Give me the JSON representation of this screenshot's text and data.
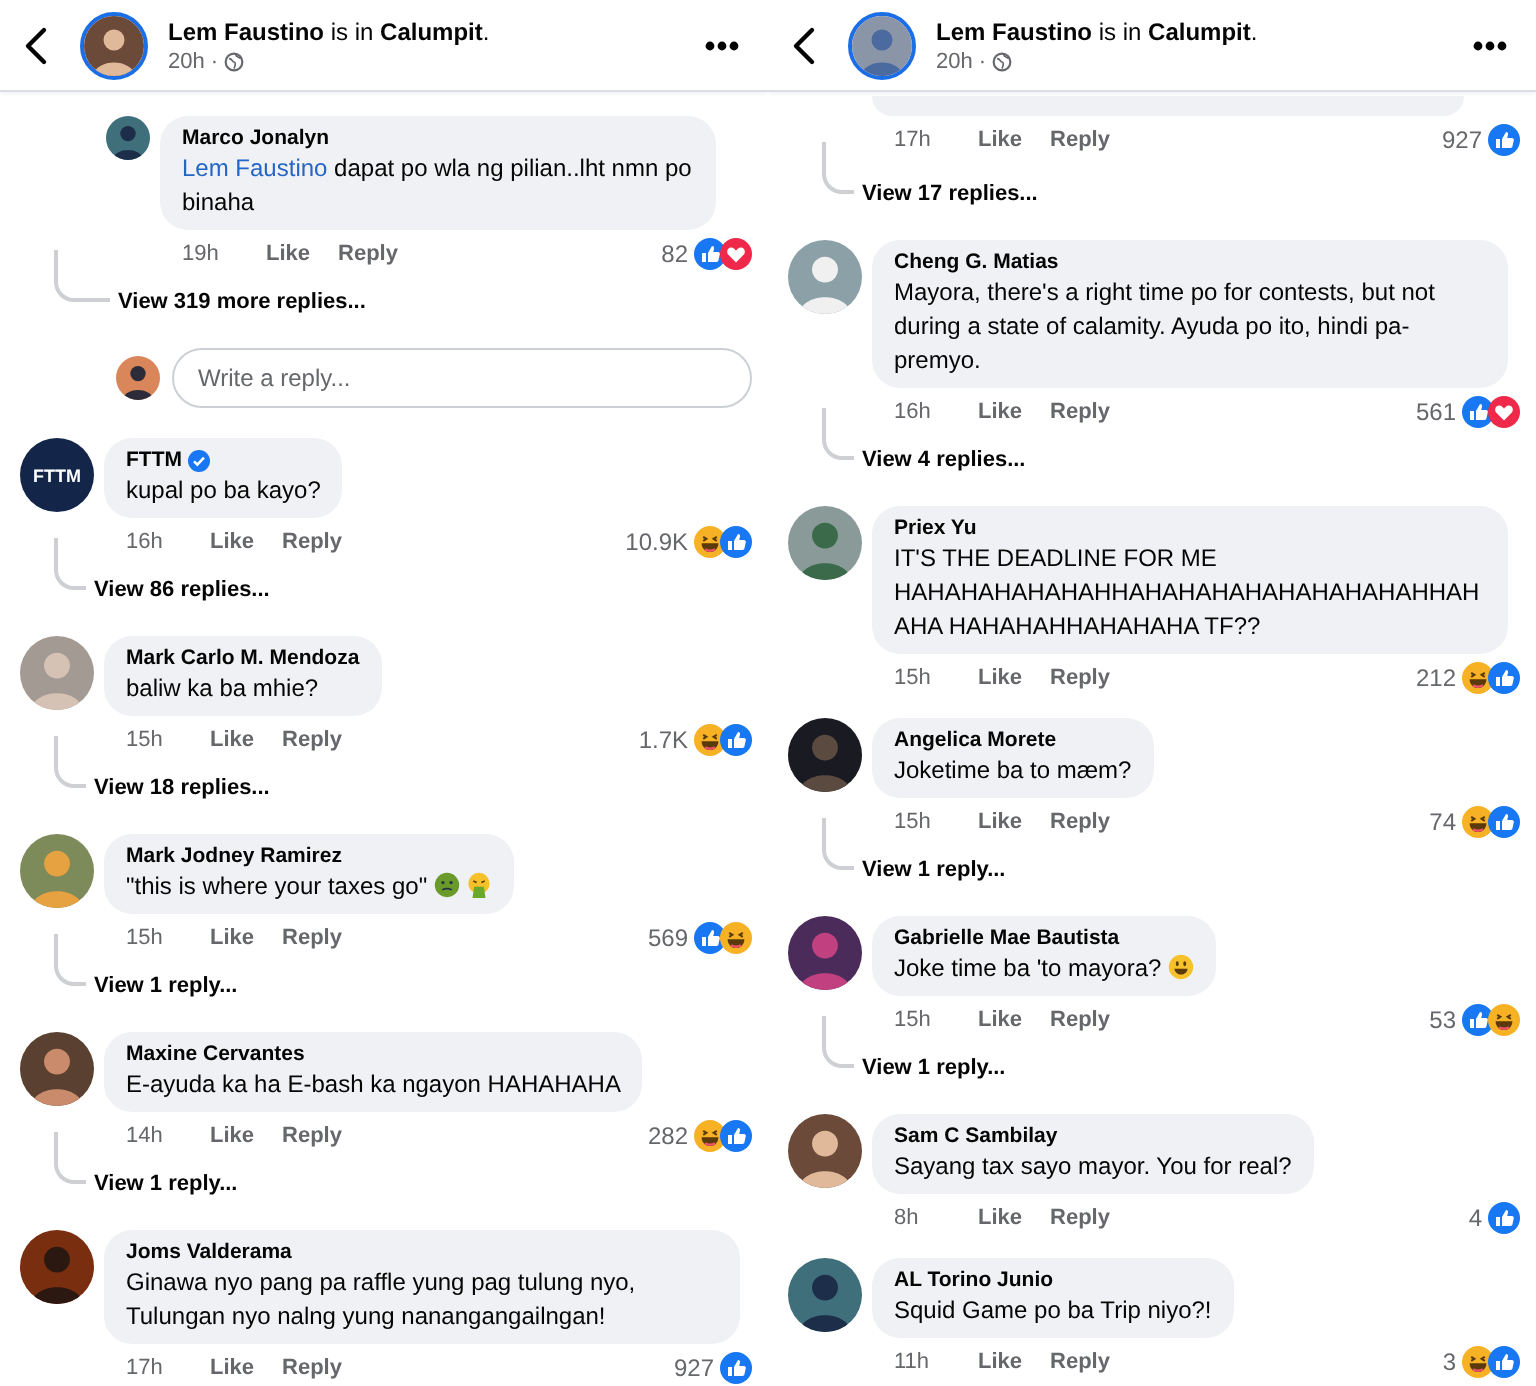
{
  "panels": [
    {
      "header": {
        "title": "**Lem Faustino** is in **Calumpit**.",
        "time": "20h ·"
      },
      "items": [
        {
          "kind": "reply",
          "author": "Marco Jonalyn",
          "verified": false,
          "mention": "Lem Faustino",
          "text": "dapat po wla ng pilian..lht nmn po binaha",
          "time": "19h",
          "like": "Like",
          "reply_label": "Reply",
          "count": "82",
          "reactions": [
            {
              "kind": "like"
            },
            {
              "kind": "love"
            }
          ]
        },
        {
          "kind": "more_replies",
          "label": "View 319 more replies..."
        },
        {
          "kind": "reply_box",
          "placeholder": "Write a reply..."
        },
        {
          "kind": "comment",
          "author": "FTTM",
          "avatar_text": "FTTM",
          "verified": true,
          "text": "kupal po ba kayo?",
          "time": "16h",
          "like": "Like",
          "reply_label": "Reply",
          "count": "10.9K",
          "reactions": [
            {
              "kind": "haha"
            },
            {
              "kind": "like"
            }
          ]
        },
        {
          "kind": "view_replies",
          "label": "View 86 replies..."
        },
        {
          "kind": "comment",
          "author": "Mark Carlo M. Mendoza",
          "verified": false,
          "text": "baliw  ka ba mhie?",
          "time": "15h",
          "like": "Like",
          "reply_label": "Reply",
          "count": "1.7K",
          "reactions": [
            {
              "kind": "haha"
            },
            {
              "kind": "like"
            }
          ]
        },
        {
          "kind": "view_replies",
          "label": "View 18 replies..."
        },
        {
          "kind": "comment",
          "author": "Mark Jodney Ramirez",
          "verified": false,
          "text": "\"this is where your taxes go\"",
          "emojis": [
            {
              "kind": "nauseated"
            },
            {
              "kind": "vomiting"
            }
          ],
          "time": "15h",
          "like": "Like",
          "reply_label": "Reply",
          "count": "569",
          "reactions": [
            {
              "kind": "like"
            },
            {
              "kind": "haha"
            }
          ]
        },
        {
          "kind": "view_replies",
          "label": "View 1 reply..."
        },
        {
          "kind": "comment",
          "author": "Maxine Cervantes",
          "verified": false,
          "text": "E-ayuda ka ha E-bash ka ngayon HAHAHAHA",
          "time": "14h",
          "like": "Like",
          "reply_label": "Reply",
          "count": "282",
          "reactions": [
            {
              "kind": "haha"
            },
            {
              "kind": "like"
            }
          ]
        },
        {
          "kind": "view_replies",
          "label": "View 1 reply..."
        },
        {
          "kind": "comment",
          "author": "Joms Valderama",
          "verified": false,
          "text": "Ginawa nyo pang pa raffle yung pag tulung nyo, Tulungan nyo nalng yung nanangangailngan!",
          "time": "17h",
          "like": "Like",
          "reply_label": "Reply",
          "count": "927",
          "reactions": [
            {
              "kind": "like"
            }
          ]
        }
      ]
    },
    {
      "header": {
        "title": "**Lem Faustino** is in **Calumpit**.",
        "time": "20h ·"
      },
      "items": [
        {
          "kind": "cut_comment",
          "time": "17h",
          "like": "Like",
          "reply_label": "Reply",
          "count": "927",
          "reactions": [
            {
              "kind": "like"
            }
          ]
        },
        {
          "kind": "view_replies",
          "label": "View 17 replies..."
        },
        {
          "kind": "comment",
          "author": "Cheng G. Matias",
          "verified": false,
          "text": "Mayora, there's a right time po for contests, but not during a state of calamity. Ayuda po ito, hindi pa-premyo.",
          "time": "16h",
          "like": "Like",
          "reply_label": "Reply",
          "count": "561",
          "reactions": [
            {
              "kind": "like"
            },
            {
              "kind": "love"
            }
          ]
        },
        {
          "kind": "view_replies",
          "label": "View 4 replies..."
        },
        {
          "kind": "comment",
          "author": "Priex Yu",
          "verified": false,
          "text": "IT'S THE DEADLINE FOR ME HAHAHAHAHAHAHHAHAHAHAHAHAHAHAHAHHAHAHA HAHAHAHHAHAHAHA TF??",
          "time": "15h",
          "like": "Like",
          "reply_label": "Reply",
          "count": "212",
          "reactions": [
            {
              "kind": "haha"
            },
            {
              "kind": "like"
            }
          ]
        },
        {
          "kind": "comment",
          "author": "Angelica Morete",
          "verified": false,
          "text": "Joketime ba to mæm?",
          "time": "15h",
          "like": "Like",
          "reply_label": "Reply",
          "count": "74",
          "reactions": [
            {
              "kind": "haha"
            },
            {
              "kind": "like"
            }
          ]
        },
        {
          "kind": "view_replies",
          "label": "View 1 reply..."
        },
        {
          "kind": "comment",
          "author": "Gabrielle Mae Bautista",
          "verified": false,
          "text": "Joke time ba 'to mayora?",
          "emojis": [
            {
              "kind": "smiley"
            }
          ],
          "time": "15h",
          "like": "Like",
          "reply_label": "Reply",
          "count": "53",
          "reactions": [
            {
              "kind": "like"
            },
            {
              "kind": "haha"
            }
          ]
        },
        {
          "kind": "view_replies",
          "label": "View 1 reply..."
        },
        {
          "kind": "comment",
          "author": "Sam C Sambilay",
          "verified": false,
          "text": "Sayang tax sayo mayor. You for real?",
          "time": "8h",
          "like": "Like",
          "reply_label": "Reply",
          "count": "4",
          "reactions": [
            {
              "kind": "like"
            }
          ]
        },
        {
          "kind": "comment",
          "author": "AL Torino Junio",
          "verified": false,
          "text": "Squid Game po ba Trip niyo?!",
          "time": "11h",
          "like": "Like",
          "reply_label": "Reply",
          "count": "3",
          "reactions": [
            {
              "kind": "haha"
            },
            {
              "kind": "like"
            }
          ]
        }
      ]
    }
  ]
}
